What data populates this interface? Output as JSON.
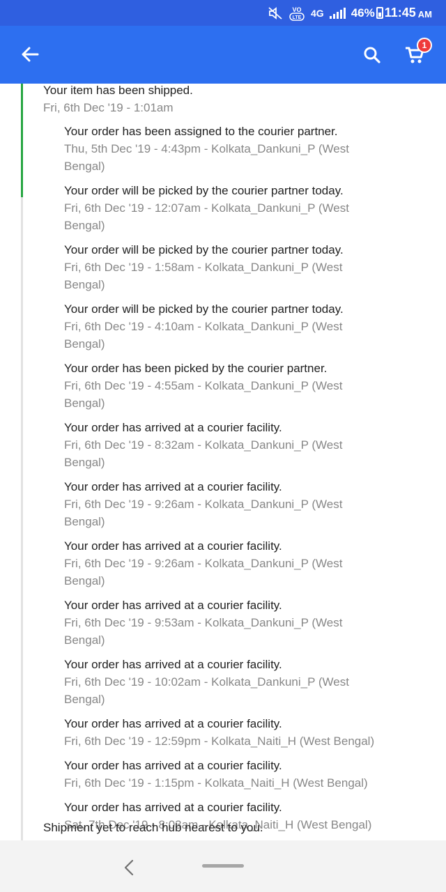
{
  "status_bar": {
    "network": "4G",
    "battery_percent": "46%",
    "time": "11:45",
    "ampm": "AM",
    "icons": [
      "mute-icon",
      "volte-icon",
      "signal-icon",
      "battery-icon"
    ],
    "color": "#2f5fe0"
  },
  "app_bar": {
    "color": "#2d6ff0",
    "icons": [
      "back-arrow-icon",
      "search-icon",
      "cart-icon"
    ],
    "cart_count": "1"
  },
  "timeline": {
    "progress_color": "#26a541",
    "primary_title": "Your item has been shipped.",
    "primary_time": "Fri, 6th Dec '19 - 1:01am",
    "events": [
      {
        "title": "Your order has been assigned to the courier partner.",
        "detail_line1": "Thu, 5th Dec '19 - 4:43pm - Kolkata_Dankuni_P (West",
        "detail_line2": "Bengal)"
      },
      {
        "title": "Your order will be picked by the courier partner today.",
        "detail_line1": "Fri, 6th Dec '19 - 12:07am - Kolkata_Dankuni_P (West",
        "detail_line2": "Bengal)"
      },
      {
        "title": "Your order will be picked by the courier partner today.",
        "detail_line1": "Fri, 6th Dec '19 - 1:58am - Kolkata_Dankuni_P (West",
        "detail_line2": "Bengal)"
      },
      {
        "title": "Your order will be picked by the courier partner today.",
        "detail_line1": "Fri, 6th Dec '19 - 4:10am - Kolkata_Dankuni_P (West",
        "detail_line2": "Bengal)"
      },
      {
        "title": "Your order has been picked by the courier partner.",
        "detail_line1": "Fri, 6th Dec '19 - 4:55am - Kolkata_Dankuni_P (West",
        "detail_line2": "Bengal)"
      },
      {
        "title": "Your order has arrived at a courier facility.",
        "detail_line1": "Fri, 6th Dec '19 - 8:32am - Kolkata_Dankuni_P (West",
        "detail_line2": "Bengal)"
      },
      {
        "title": "Your order has arrived at a courier facility.",
        "detail_line1": "Fri, 6th Dec '19 - 9:26am - Kolkata_Dankuni_P (West",
        "detail_line2": "Bengal)"
      },
      {
        "title": "Your order has arrived at a courier facility.",
        "detail_line1": "Fri, 6th Dec '19 - 9:26am - Kolkata_Dankuni_P (West",
        "detail_line2": "Bengal)"
      },
      {
        "title": "Your order has arrived at a courier facility.",
        "detail_line1": "Fri, 6th Dec '19 - 9:53am - Kolkata_Dankuni_P (West",
        "detail_line2": "Bengal)"
      },
      {
        "title": "Your order has arrived at a courier facility.",
        "detail_line1": "Fri, 6th Dec '19 - 10:02am - Kolkata_Dankuni_P (West",
        "detail_line2": "Bengal)"
      },
      {
        "title": "Your order has arrived at a courier facility.",
        "detail_line1": "Fri, 6th Dec '19 - 12:59pm - Kolkata_Naiti_H (West Bengal)",
        "detail_line2": ""
      },
      {
        "title": "Your order has arrived at a courier facility.",
        "detail_line1": "Fri, 6th Dec '19 - 1:15pm - Kolkata_Naiti_H (West Bengal)",
        "detail_line2": ""
      },
      {
        "title": "Your order has arrived at a courier facility.",
        "detail_line1": "Sat, 7th Dec '19 - 8:03am - Kolkata_Naiti_H (West Bengal)",
        "detail_line2": ""
      }
    ],
    "footer_status": "Shipment yet to reach hub nearest to you."
  },
  "nav_bar": {
    "icons": [
      "nav-back-icon",
      "home-pill-icon"
    ]
  }
}
